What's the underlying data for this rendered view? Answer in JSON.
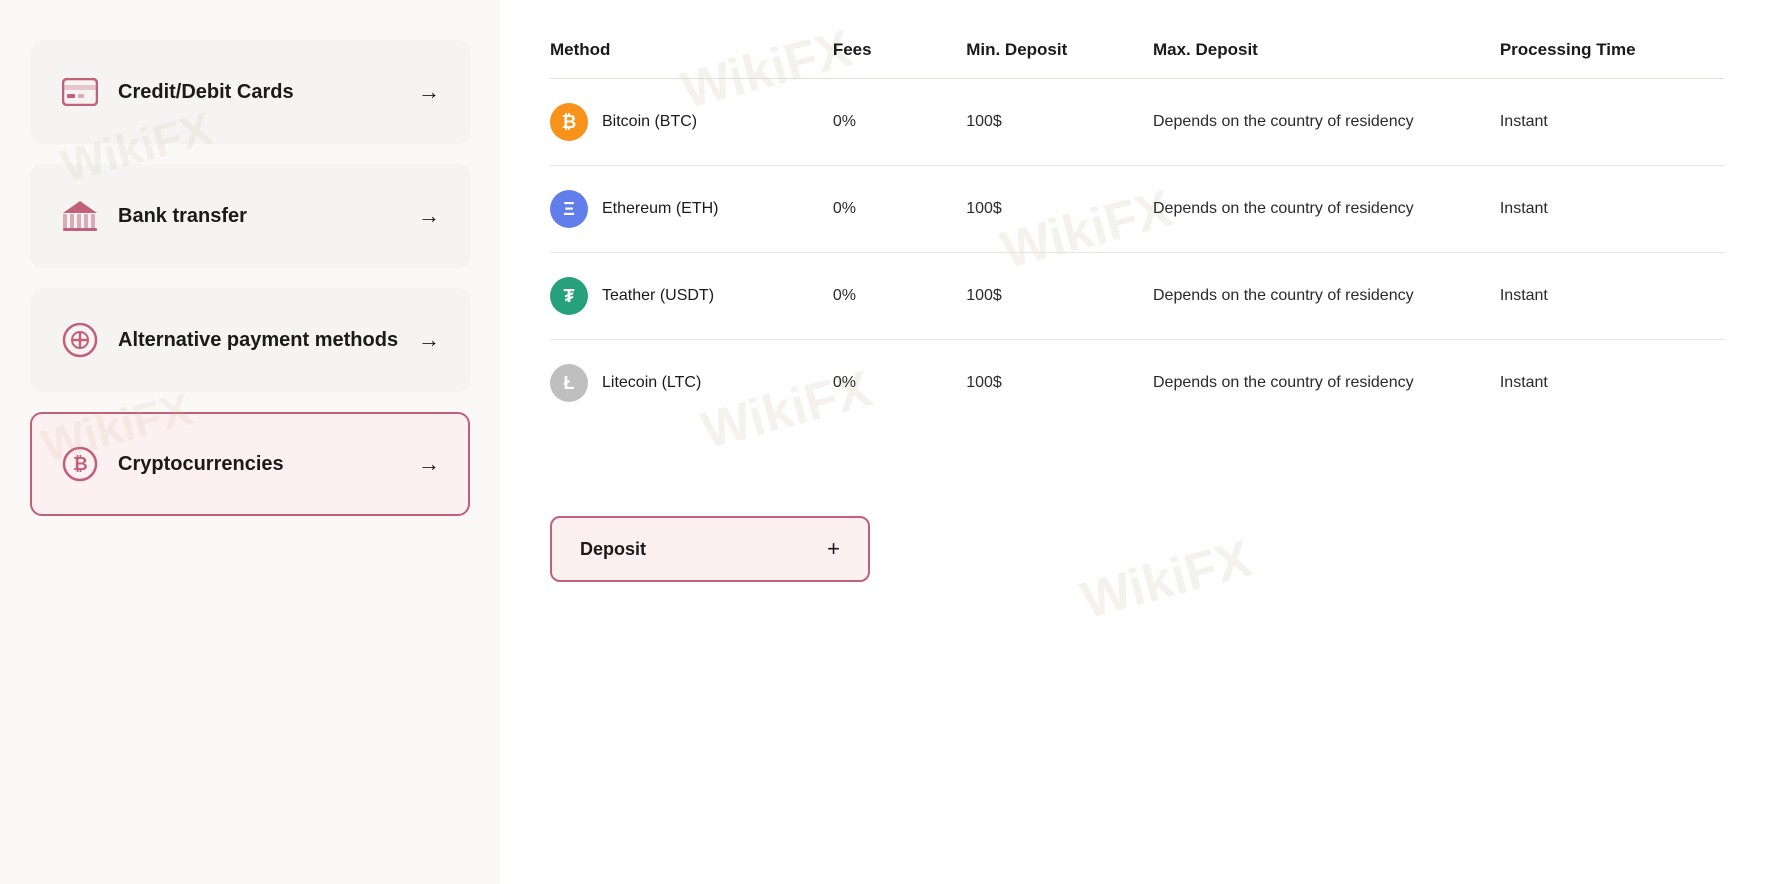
{
  "leftPanel": {
    "items": [
      {
        "id": "credit-debit",
        "label": "Credit/Debit Cards",
        "iconType": "card",
        "active": false
      },
      {
        "id": "bank-transfer",
        "label": "Bank transfer",
        "iconType": "bank",
        "active": false
      },
      {
        "id": "alternative",
        "label": "Alternative payment methods",
        "iconType": "circle-plus",
        "active": false
      },
      {
        "id": "cryptocurrencies",
        "label": "Cryptocurrencies",
        "iconType": "bitcoin",
        "active": true
      }
    ],
    "arrowLabel": "→"
  },
  "rightPanel": {
    "table": {
      "headers": {
        "method": "Method",
        "fees": "Fees",
        "minDeposit": "Min. Deposit",
        "maxDeposit": "Max. Deposit",
        "processingTime": "Processing Time"
      },
      "rows": [
        {
          "id": "btc",
          "iconClass": "icon-btc",
          "iconSymbol": "₿",
          "name": "Bitcoin (BTC)",
          "fees": "0%",
          "minDeposit": "100$",
          "maxDeposit": "Depends on the country of residency",
          "processingTime": "Instant"
        },
        {
          "id": "eth",
          "iconClass": "icon-eth",
          "iconSymbol": "Ξ",
          "name": "Ethereum (ETH)",
          "fees": "0%",
          "minDeposit": "100$",
          "maxDeposit": "Depends on the country of residency",
          "processingTime": "Instant"
        },
        {
          "id": "usdt",
          "iconClass": "icon-usdt",
          "iconSymbol": "₮",
          "name": "Teather (USDT)",
          "fees": "0%",
          "minDeposit": "100$",
          "maxDeposit": "Depends on the country of residency",
          "processingTime": "Instant"
        },
        {
          "id": "ltc",
          "iconClass": "icon-ltc",
          "iconSymbol": "Ł",
          "name": "Litecoin (LTC)",
          "fees": "0%",
          "minDeposit": "100$",
          "maxDeposit": "Depends on the country of residency",
          "processingTime": "Instant"
        }
      ]
    },
    "depositButton": {
      "label": "Deposit",
      "plusSymbol": "+"
    },
    "watermarkText": "WikiFX"
  }
}
